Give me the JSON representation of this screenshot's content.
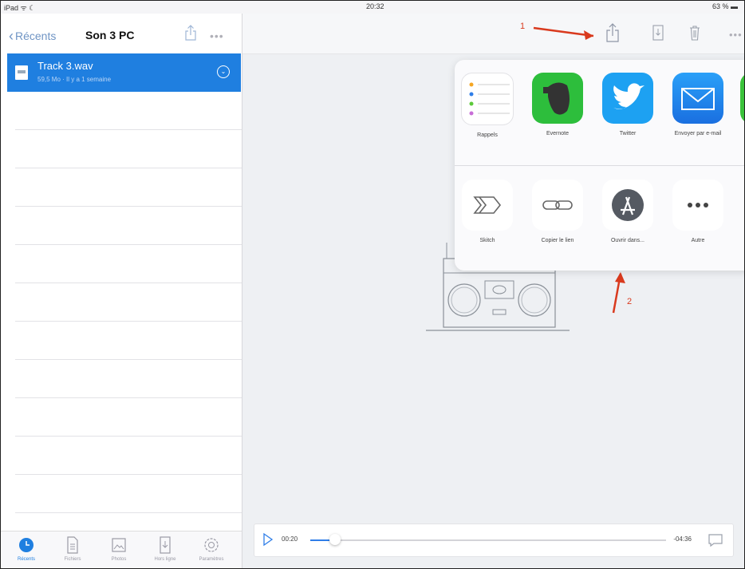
{
  "status_bar": {
    "left": "iPad ᯤ ☾",
    "time": "20:32",
    "battery": "63 % ▬"
  },
  "left_nav": {
    "back_label": "Récents",
    "title": "Son 3 PC"
  },
  "file": {
    "name": "Track 3.wav",
    "meta": "59,5 Mo · Il y a 1 semaine"
  },
  "tabs": [
    {
      "label": "Récents",
      "icon": "clock-icon",
      "active": true
    },
    {
      "label": "Fichiers",
      "icon": "document-icon",
      "active": false
    },
    {
      "label": "Photos",
      "icon": "photo-icon",
      "active": false
    },
    {
      "label": "Hors ligne",
      "icon": "download-icon",
      "active": false
    },
    {
      "label": "Paramètres",
      "icon": "gear-icon",
      "active": false
    }
  ],
  "annotations": {
    "first": "1",
    "second": "2"
  },
  "share_sheet": {
    "row1": [
      {
        "label": "Rappels",
        "icon": "reminders-icon"
      },
      {
        "label": "Evernote",
        "icon": "evernote-icon"
      },
      {
        "label": "Twitter",
        "icon": "twitter-icon"
      },
      {
        "label": "Envoyer par e-mail",
        "icon": "mail-icon"
      }
    ],
    "row2": [
      {
        "label": "Skitch",
        "icon": "skitch-icon"
      },
      {
        "label": "Copier le lien",
        "icon": "link-icon"
      },
      {
        "label": "Ouvrir dans...",
        "icon": "app-store-icon"
      },
      {
        "label": "Autre",
        "icon": "more-icon"
      }
    ]
  },
  "player": {
    "current": "00:20",
    "remaining": "-04:36",
    "progress_fraction": 0.07
  },
  "colors": {
    "accent": "#1f7fe0",
    "annotation": "#d93a1e",
    "evernote": "#2dbe3c",
    "twitter": "#1da1f2",
    "mail": "#1a82f0"
  }
}
